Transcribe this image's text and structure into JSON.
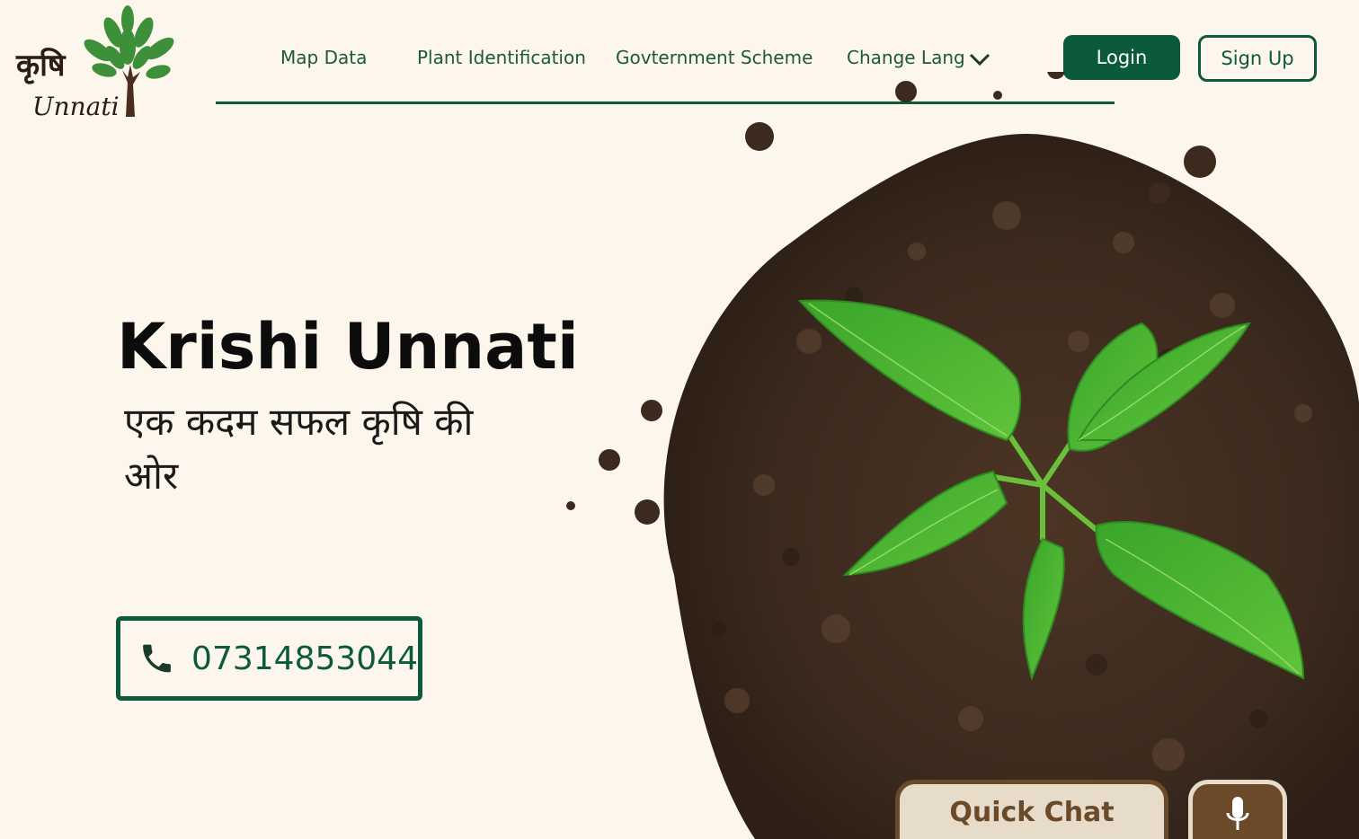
{
  "brand": {
    "logo_hindi": "कृषि",
    "logo_english": "Unnati"
  },
  "nav": {
    "items": [
      {
        "label": "Map Data"
      },
      {
        "label": "Plant Identification"
      },
      {
        "label": "Govternment Scheme"
      },
      {
        "label": "Change Lang"
      }
    ],
    "login_label": "Login",
    "signup_label": "Sign Up"
  },
  "hero": {
    "title": "Krishi Unnati",
    "subtitle": "एक कदम सफल कृषि की ओर",
    "phone": "07314853044"
  },
  "chat": {
    "quick_chat_label": "Quick Chat"
  },
  "icons": {
    "phone": "phone-icon",
    "mic": "microphone-icon",
    "dropdown": "chevron-down-icon"
  },
  "colors": {
    "background": "#fdf6ec",
    "primary_green": "#0c5a3c",
    "brown": "#6b4a2a",
    "chat_bg": "#e6dcc9"
  }
}
